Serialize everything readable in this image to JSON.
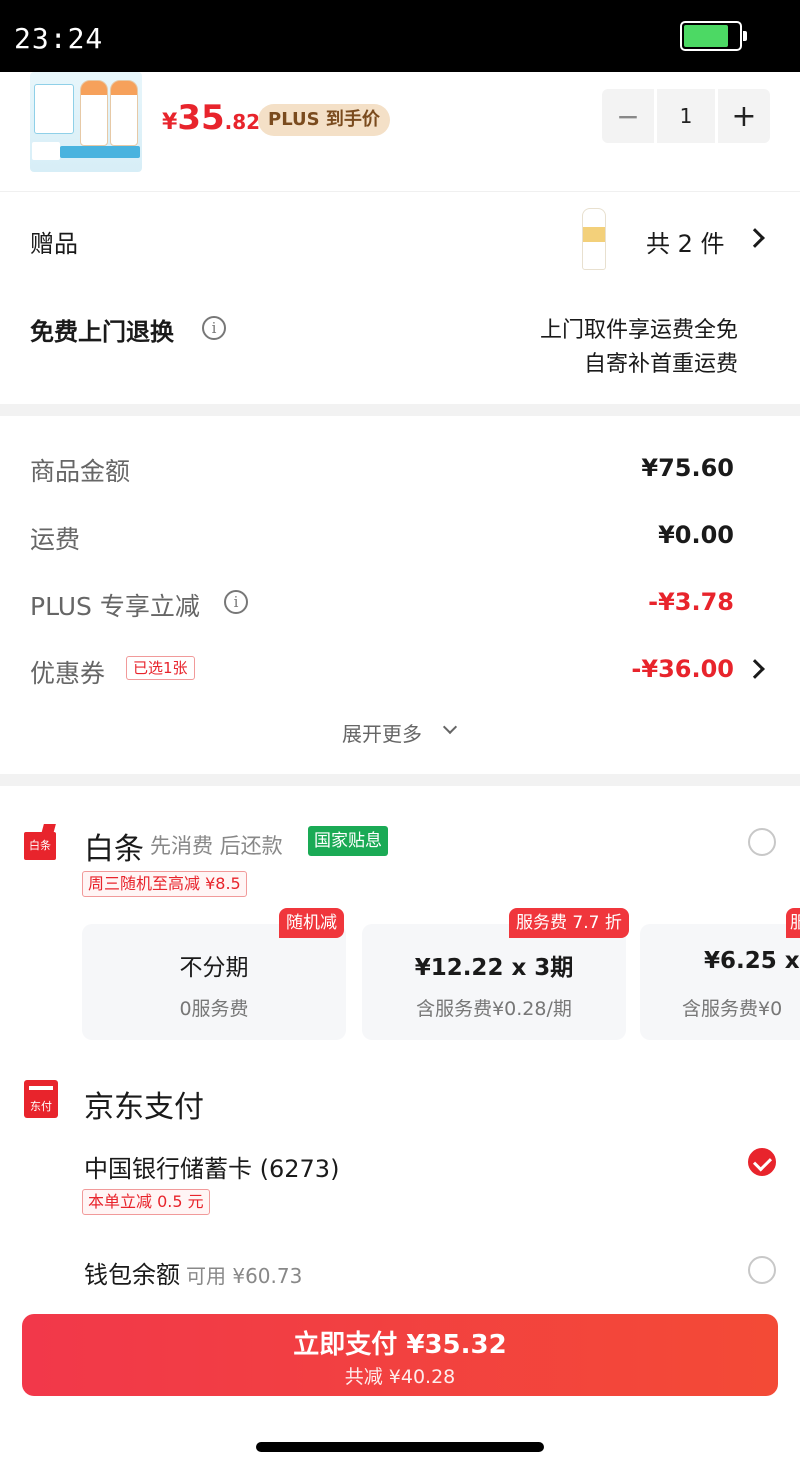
{
  "status_bar": {
    "time": "23:24"
  },
  "product": {
    "price_currency": "¥",
    "price_int": "35",
    "price_dec": ".82",
    "plus_tag": "PLUS 到手价",
    "quantity": "1",
    "minus_symbol": "−",
    "plus_symbol": "+"
  },
  "gift": {
    "label": "赠品",
    "count": "共 2 件"
  },
  "return_service": {
    "label": "免费上门退换",
    "line1": "上门取件享运费全免",
    "line2": "自寄补首重运费"
  },
  "amounts": {
    "goods_label": "商品金额",
    "goods_value": "¥75.60",
    "shipping_label": "运费",
    "shipping_value": "¥0.00",
    "plus_label": "PLUS 专享立减",
    "plus_value": "-¥3.78",
    "coupon_label": "优惠券",
    "coupon_tag": "已选1张",
    "coupon_value": "-¥36.00",
    "expand_label": "展开更多"
  },
  "baitiao": {
    "icon_text": "白条",
    "title": "白条",
    "subtitle": "先消费 后还款",
    "gov_tag": "国家贴息",
    "promo": "周三随机至高减 ¥8.5",
    "installments": [
      {
        "badge": "随机减",
        "main": "不分期",
        "sub": "0服务费"
      },
      {
        "badge": "服务费 7.7 折",
        "main": "¥12.22 x 3期",
        "sub": "含服务费¥0.28/期"
      },
      {
        "badge": "服",
        "main": "¥6.25 x",
        "sub": "含服务费¥0"
      }
    ]
  },
  "jd_pay": {
    "icon_text": "东付",
    "title": "京东支付",
    "card_label": "中国银行储蓄卡 (6273)",
    "card_promo": "本单立减 0.5 元",
    "wallet_label": "钱包余额",
    "wallet_available": "可用 ¥60.73"
  },
  "pay_button": {
    "label": "立即支付 ¥35.32",
    "savings": "共减 ¥40.28"
  },
  "colors": {
    "accent_red": "#e8242c",
    "gov_green": "#1aaa55",
    "plus_gold": "#f4e0c7"
  }
}
